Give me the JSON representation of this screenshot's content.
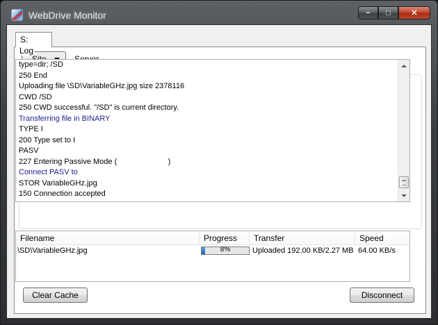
{
  "window": {
    "title": "WebDrive Monitor",
    "minimize": "−",
    "maximize": "□",
    "close": "✕"
  },
  "tab": {
    "label": "S:"
  },
  "toolbar": {
    "site_label": "Site",
    "server_label": "Server"
  },
  "log": {
    "label": "Log",
    "lines": [
      {
        "text": "type=dir; /SD",
        "blue": false
      },
      {
        "text": "250 End",
        "blue": false
      },
      {
        "text": "Uploading file \\SD\\VariableGHz.jpg size 2378116",
        "blue": false
      },
      {
        "text": "CWD /SD",
        "blue": false
      },
      {
        "text": "250 CWD successful. \"/SD\" is current directory.",
        "blue": false
      },
      {
        "text": "Transferring file in BINARY",
        "blue": true
      },
      {
        "text": "TYPE I",
        "blue": false
      },
      {
        "text": "200 Type set to I",
        "blue": false
      },
      {
        "text": "PASV",
        "blue": false
      },
      {
        "text": "227 Entering Passive Mode (                        )",
        "blue": false
      },
      {
        "text": "Connect PASV to",
        "blue": true
      },
      {
        "text": "STOR VariableGHz.jpg",
        "blue": false
      },
      {
        "text": "150 Connection accepted",
        "blue": false
      }
    ]
  },
  "transfers": {
    "columns": [
      "Filename",
      "Progress",
      "Transfer",
      "Speed"
    ],
    "rows": [
      {
        "filename": "\\SD\\VariableGHz.jpg",
        "progress": 8,
        "progress_label": "8%",
        "transfer": "Uploaded 192.00 KB/2.27 MB",
        "speed": "64.00 KB/s"
      }
    ]
  },
  "buttons": {
    "clear_cache": "Clear Cache",
    "disconnect": "Disconnect"
  },
  "colors": {
    "log_blue": "#1c1c8f",
    "progress_fill": "#1f5fb8"
  }
}
